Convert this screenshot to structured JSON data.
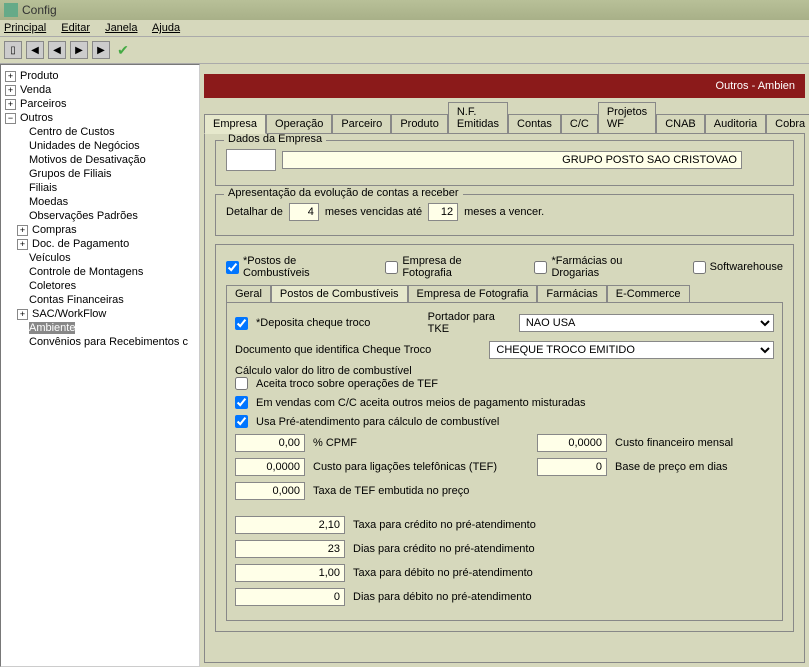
{
  "window": {
    "title": "Config"
  },
  "menu": {
    "principal": "Principal",
    "editar": "Editar",
    "janela": "Janela",
    "ajuda": "Ajuda"
  },
  "tree": {
    "produto": "Produto",
    "venda": "Venda",
    "parceiros": "Parceiros",
    "outros": "Outros",
    "children": {
      "centro_custos": "Centro de Custos",
      "unidades_negocios": "Unidades de Negócios",
      "motivos_desativacao": "Motivos de Desativação",
      "grupos_filiais": "Grupos de Filiais",
      "filiais": "Filiais",
      "moedas": "Moedas",
      "observacoes_padroes": "Observações Padrões",
      "compras": "Compras",
      "doc_pagamento": "Doc. de Pagamento",
      "veiculos": "Veículos",
      "controle_montagens": "Controle de Montagens",
      "coletores": "Coletores",
      "contas_financeiras": "Contas Financeiras",
      "sac_workflow": "SAC/WorkFlow",
      "ambiente": "Ambiente",
      "convenios": "Convênios para Recebimentos c"
    }
  },
  "header": {
    "title": "Outros - Ambien"
  },
  "tabs": {
    "empresa": "Empresa",
    "operacao": "Operação",
    "parceiro": "Parceiro",
    "produto": "Produto",
    "nf_emitidas": "N.F. Emitidas",
    "contas": "Contas",
    "cc": "C/C",
    "projetos_wf": "Projetos WF",
    "cnab": "CNAB",
    "auditoria": "Auditoria",
    "cobra": "Cobra"
  },
  "empresa_group": {
    "title": "Dados da Empresa",
    "company_name": "GRUPO POSTO SAO CRISTOVAO"
  },
  "contas_group": {
    "title": "Apresentação da evolução de contas a receber",
    "detalhar_de": "Detalhar de",
    "meses_venc": "4",
    "meses_vencidas_ate": "meses vencidas até",
    "meses_vencer_val": "12",
    "meses_vencer": "meses a vencer."
  },
  "checkboxes": {
    "postos": "*Postos de Combustíveis",
    "fotografia": "Empresa de Fotografia",
    "farmacias": "*Farmácias ou Drogarias",
    "softwarehouse": "Softwarehouse"
  },
  "subtabs": {
    "geral": "Geral",
    "postos": "Postos de Combustíveis",
    "fotografia": "Empresa de Fotografia",
    "farmacias": "Farmácias",
    "ecommerce": "E-Commerce"
  },
  "fields": {
    "deposita_cheque": "*Deposita cheque troco",
    "portador_tke": "Portador para TKE",
    "portador_tke_val": "NAO USA",
    "doc_cheque": "Documento que identifica Cheque Troco",
    "doc_cheque_val": "CHEQUE TROCO EMITIDO",
    "calc_title": "Cálculo valor do litro de combustível",
    "aceita_troco": "Aceita troco sobre operações de TEF",
    "vendas_cc": "Em vendas com C/C aceita outros meios de pagamento misturadas",
    "usa_pre": "Usa Pré-atendimento para cálculo de combustível",
    "cpmf_val": "0,00",
    "cpmf_lbl": "% CPMF",
    "custo_fin_val": "0,0000",
    "custo_fin_lbl": "Custo financeiro mensal",
    "custo_lig_val": "0,0000",
    "custo_lig_lbl": "Custo para ligações telefônicas (TEF)",
    "base_preco_val": "0",
    "base_preco_lbl": "Base de preço em dias",
    "taxa_tef_val": "0,000",
    "taxa_tef_lbl": "Taxa de TEF embutida no preço",
    "taxa_cred_val": "2,10",
    "taxa_cred_lbl": "Taxa para crédito no pré-atendimento",
    "dias_cred_val": "23",
    "dias_cred_lbl": "Dias para crédito no pré-atendimento",
    "taxa_deb_val": "1,00",
    "taxa_deb_lbl": "Taxa para débito no pré-atendimento",
    "dias_deb_val": "0",
    "dias_deb_lbl": "Dias para débito no pré-atendimento"
  }
}
